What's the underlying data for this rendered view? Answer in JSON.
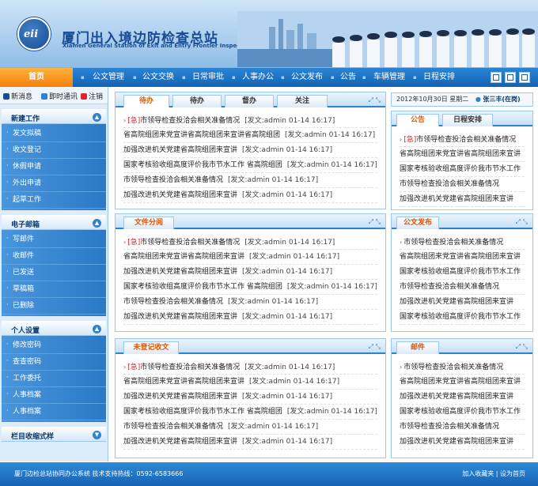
{
  "header": {
    "title_cn": "厦门出入境边防检查总站",
    "title_en": "Xiamen General Station of Exit and Entry Frontier Inspection",
    "logo_text": "eii"
  },
  "nav": {
    "home": "首页",
    "items": [
      "公文管理",
      "公文交换",
      "日常审批",
      "人事办公",
      "公文发布",
      "公告",
      "车辆管理",
      "日程安排"
    ]
  },
  "sidebar": {
    "top_links": [
      "新消息",
      "即时通讯",
      "注销"
    ],
    "groups": [
      {
        "title": "新建工作",
        "items": [
          "发文拟稿",
          "收文登记",
          "休假申请",
          "外出申请",
          "起草工作"
        ]
      },
      {
        "title": "电子邮箱",
        "items": [
          "写邮件",
          "收邮件",
          "已发送",
          "草稿箱",
          "已删除"
        ]
      },
      {
        "title": "个人设置",
        "items": [
          "修改密码",
          "查查密码",
          "工作委托",
          "人事档案",
          "人事档案"
        ]
      },
      {
        "title": "栏目收缩式样",
        "items": []
      }
    ]
  },
  "datebar": {
    "date": "2012年10月30日 星期二",
    "user": "张三丰(在岗)"
  },
  "panel_main": {
    "tabs": [
      "待办",
      "待办",
      "督办",
      "关注"
    ],
    "rows": [
      {
        "tag": "[急]",
        "text": "市领导检查投洽会相关准备情况",
        "meta": "[发文:admin 01-14 16:17]"
      },
      {
        "tag": "",
        "text": "省高院组团来党宣讲省高院组团来宣讲省高院组团",
        "meta": "[发文:admin 01-14 16:17]"
      },
      {
        "tag": "",
        "text": "加强改进机关党建省高院组团来宣讲",
        "meta": "[发文:admin 01-14 16:17]"
      },
      {
        "tag": "",
        "text": "国家考核验收组高度评价我市节水工作 省高院组团",
        "meta": "[发文:admin 01-14 16:17]"
      },
      {
        "tag": "",
        "text": "市领导检查投洽会相关准备情况",
        "meta": "[发文:admin 01-14 16:17]"
      },
      {
        "tag": "",
        "text": "加强改进机关党建省高院组团来宣讲",
        "meta": "[发文:admin 01-14 16:17]"
      }
    ]
  },
  "panel_dist": {
    "title": "文件分阅",
    "rows": [
      {
        "tag": "[急]",
        "text": "市领导检查投洽会相关准备情况",
        "meta": "[发文:admin 01-14 16:17]"
      },
      {
        "tag": "",
        "text": "省高院组团来党宣讲省高院组团来宣讲",
        "meta": "[发文:admin 01-14 16:17]"
      },
      {
        "tag": "",
        "text": "加强改进机关党建省高院组团来宣讲",
        "meta": "[发文:admin 01-14 16:17]"
      },
      {
        "tag": "",
        "text": "国家考核验收组高度评价我市节水工作 省高院组团",
        "meta": "[发文:admin 01-14 16:17]"
      },
      {
        "tag": "",
        "text": "市领导检查投洽会相关准备情况",
        "meta": "[发文:admin 01-14 16:17]"
      },
      {
        "tag": "",
        "text": "加强改进机关党建省高院组团来宣讲",
        "meta": "[发文:admin 01-14 16:17]"
      }
    ]
  },
  "panel_unreg": {
    "title": "未登记收文",
    "rows": [
      {
        "tag": "[急]",
        "text": "市领导检查投洽会相关准备情况",
        "meta": "[发文:admin 01-14 16:17]"
      },
      {
        "tag": "",
        "text": "省高院组团来党宣讲省高院组团来宣讲",
        "meta": "[发文:admin 01-14 16:17]"
      },
      {
        "tag": "",
        "text": "加强改进机关党建省高院组团来宣讲",
        "meta": "[发文:admin 01-14 16:17]"
      },
      {
        "tag": "",
        "text": "国家考核验收组高度评价我市节水工作 省高院组团",
        "meta": "[发文:admin 01-14 16:17]"
      },
      {
        "tag": "",
        "text": "市领导检查投洽会相关准备情况",
        "meta": "[发文:admin 01-14 16:17]"
      },
      {
        "tag": "",
        "text": "加强改进机关党建省高院组团来宣讲",
        "meta": "[发文:admin 01-14 16:17]"
      }
    ]
  },
  "panel_notice": {
    "tabs": [
      "公告",
      "日程安排"
    ],
    "rows": [
      {
        "tag": "[急]",
        "text": "市领导检查投洽会相关准备情况"
      },
      {
        "tag": "",
        "text": "省高院组团来党宣讲省高院组团来宣讲"
      },
      {
        "tag": "",
        "text": "国家考核验收组高度评价我市节水工作"
      },
      {
        "tag": "",
        "text": "市领导检查投洽会相关准备情况"
      },
      {
        "tag": "",
        "text": "加强改进机关党建省高院组团来宣讲"
      }
    ]
  },
  "panel_pub": {
    "title": "公文发布",
    "rows": [
      {
        "tag": "",
        "text": "市领导检查投洽会相关准备情况"
      },
      {
        "tag": "",
        "text": "省高院组团来党宣讲省高院组团来宣讲"
      },
      {
        "tag": "",
        "text": "国家考核验收组高度评价我市节水工作"
      },
      {
        "tag": "",
        "text": "市领导检查投洽会相关准备情况"
      },
      {
        "tag": "",
        "text": "加强改进机关党建省高院组团来宣讲"
      },
      {
        "tag": "",
        "text": "国家考核验收组高度评价我市节水工作"
      }
    ]
  },
  "panel_mail": {
    "title": "邮件",
    "rows": [
      {
        "tag": "",
        "text": "市领导检查投洽会相关准备情况"
      },
      {
        "tag": "",
        "text": "省高院组团来党宣讲省高院组团来宣讲"
      },
      {
        "tag": "",
        "text": "加强改进机关党建省高院组团来宣讲"
      },
      {
        "tag": "",
        "text": "国家考核验收组高度评价我市节水工作"
      },
      {
        "tag": "",
        "text": "市领导检查投洽会相关准备情况"
      },
      {
        "tag": "",
        "text": "加强改进机关党建省高院组团来宣讲"
      }
    ]
  },
  "footer": {
    "left": "厦门边检总站协同办公系统   技术支持热线：0592-6583666",
    "fav": "加入收藏夹",
    "home": "设为首页"
  },
  "colors": {
    "brand": "#1563b3",
    "accent": "#f47e09",
    "urgent": "#e2242a"
  }
}
